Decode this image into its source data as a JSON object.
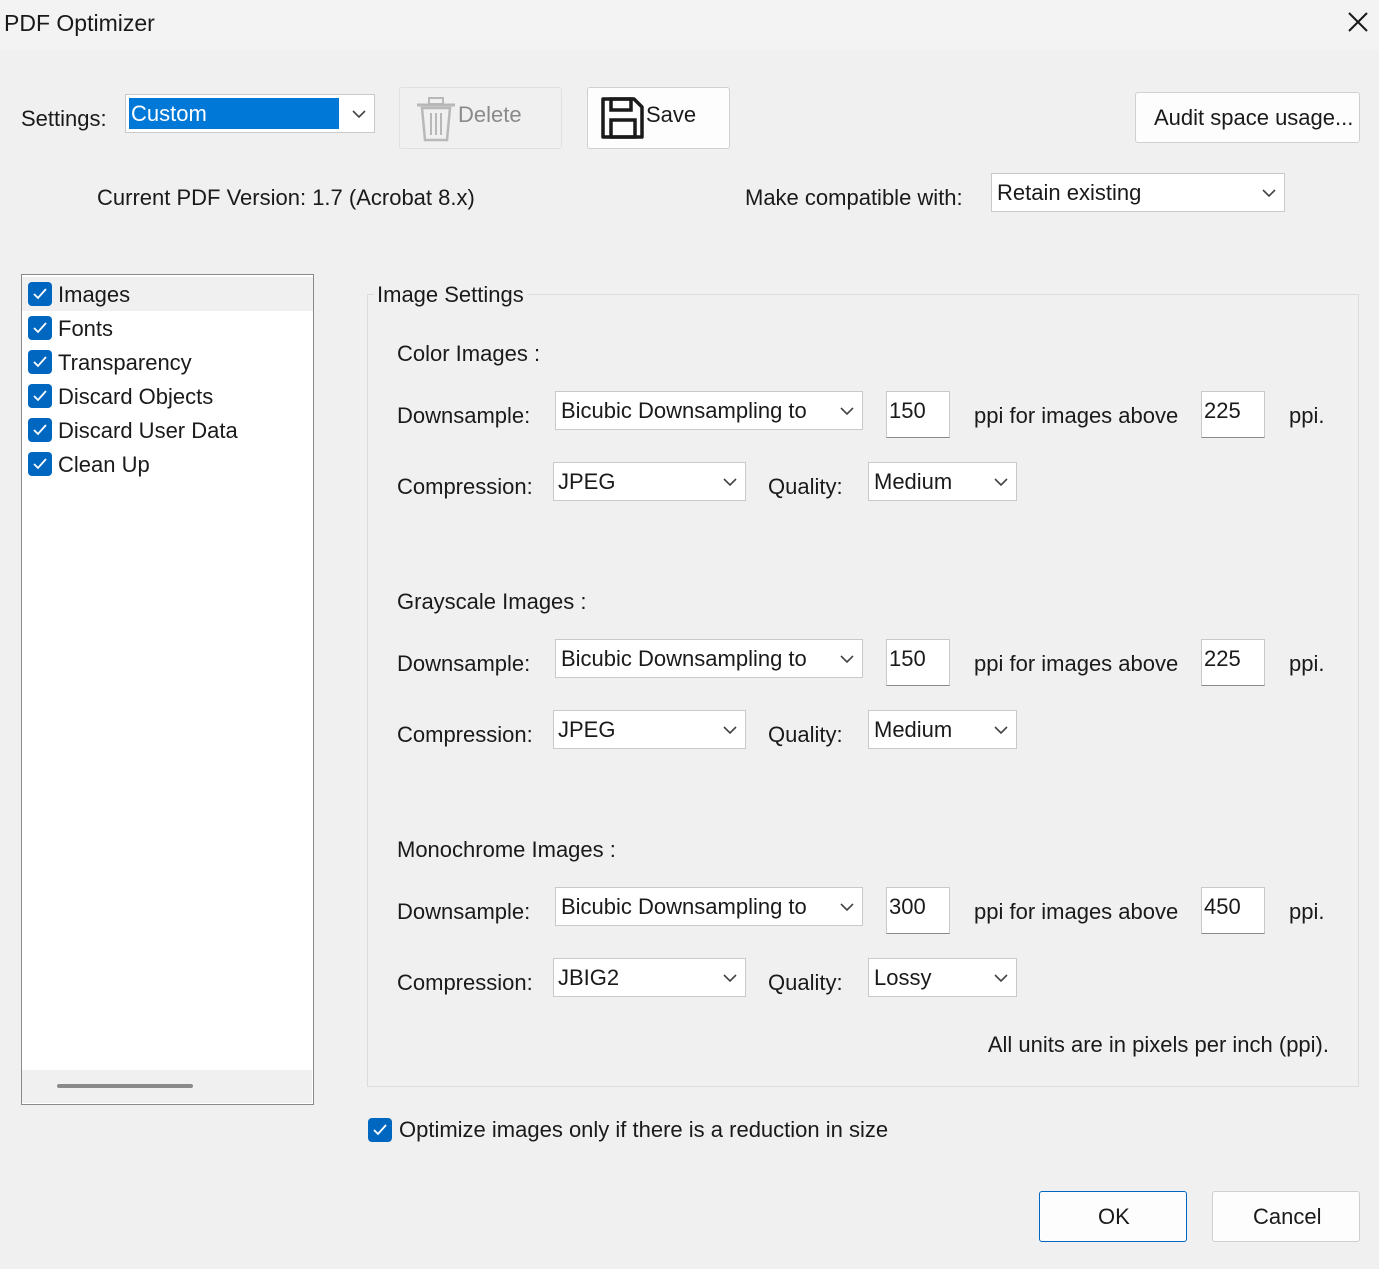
{
  "window": {
    "title": "PDF Optimizer"
  },
  "settings": {
    "label": "Settings:",
    "value": "Custom",
    "delete_label": "Delete",
    "save_label": "Save",
    "audit_label": "Audit space usage..."
  },
  "version": {
    "current": "Current PDF Version: 1.7 (Acrobat 8.x)",
    "compat_label": "Make compatible with:",
    "compat_value": "Retain existing"
  },
  "sidebar": {
    "items": [
      {
        "label": "Images",
        "checked": true
      },
      {
        "label": "Fonts",
        "checked": true
      },
      {
        "label": "Transparency",
        "checked": true
      },
      {
        "label": "Discard Objects",
        "checked": true
      },
      {
        "label": "Discard User Data",
        "checked": true
      },
      {
        "label": "Clean Up",
        "checked": true
      }
    ]
  },
  "image_settings": {
    "legend": "Image Settings",
    "downsample_label": "Downsample:",
    "compression_label": "Compression:",
    "quality_label": "Quality:",
    "ppi_above_label": "ppi for images above",
    "ppi_label": "ppi.",
    "sections": [
      {
        "title": "Color Images :",
        "method": "Bicubic Downsampling to",
        "target_ppi": "150",
        "above_ppi": "225",
        "compression": "JPEG",
        "quality": "Medium"
      },
      {
        "title": "Grayscale Images :",
        "method": "Bicubic Downsampling to",
        "target_ppi": "150",
        "above_ppi": "225",
        "compression": "JPEG",
        "quality": "Medium"
      },
      {
        "title": "Monochrome Images :",
        "method": "Bicubic Downsampling to",
        "target_ppi": "300",
        "above_ppi": "450",
        "compression": "JBIG2",
        "quality": "Lossy"
      }
    ],
    "units_note": "All units are in pixels per inch (ppi)."
  },
  "optimize_only": {
    "label": "Optimize images only if there is a reduction in size",
    "checked": true
  },
  "footer": {
    "ok_label": "OK",
    "cancel_label": "Cancel"
  },
  "colors": {
    "accent": "#0067c0",
    "selection": "#0078d7"
  },
  "icons": {
    "close": "close-icon",
    "delete": "trash-icon",
    "save": "floppy-disk-icon",
    "dropdown": "chevron-down-icon",
    "check": "checkmark-icon"
  }
}
